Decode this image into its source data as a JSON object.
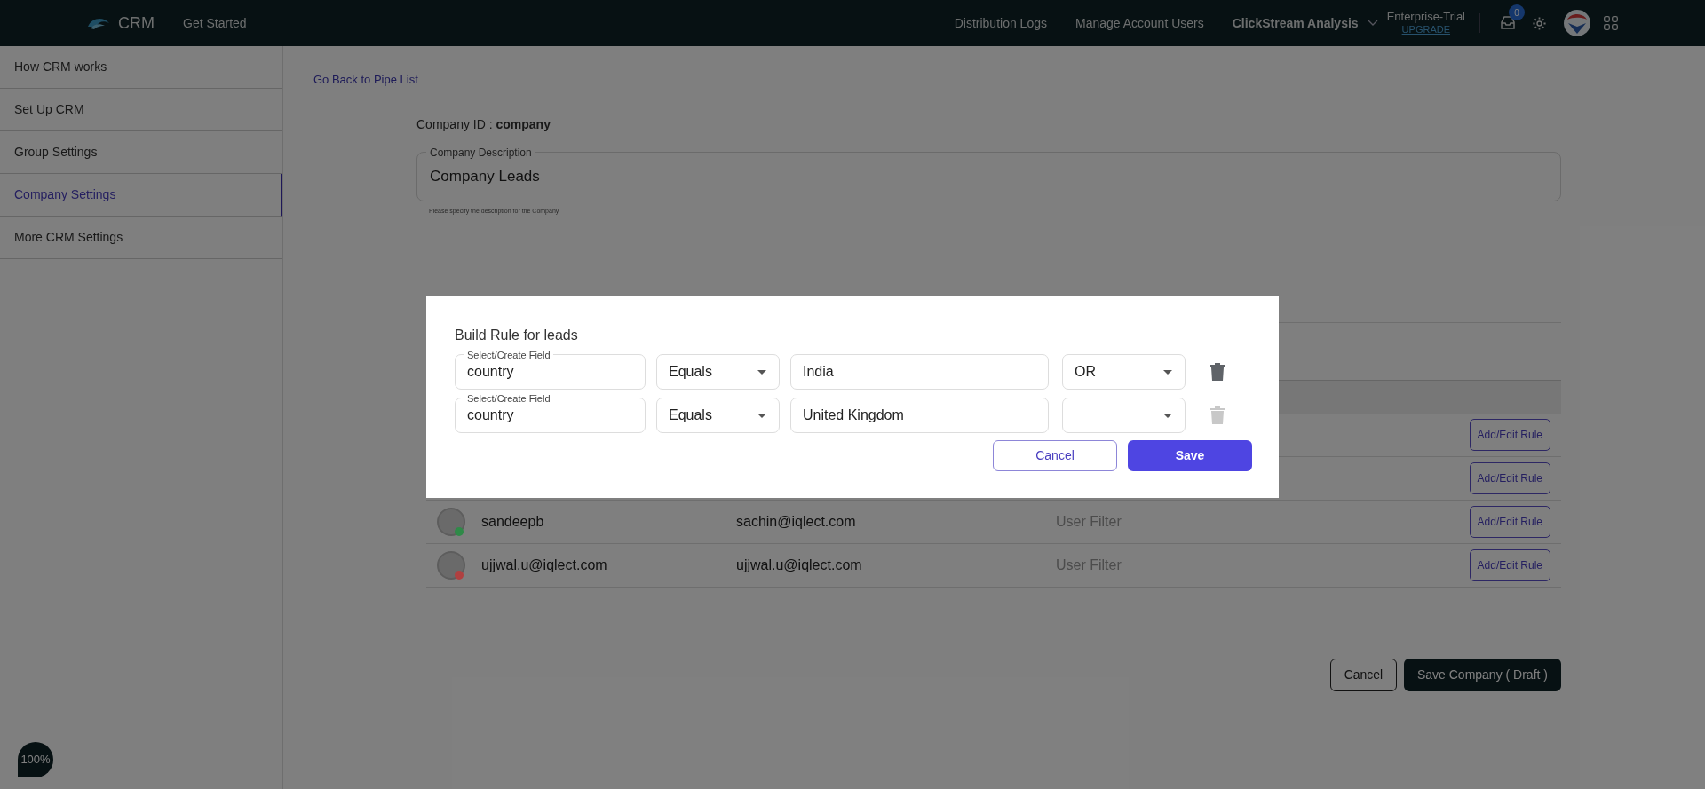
{
  "topbar": {
    "logo_text": "CRM",
    "get_started": "Get Started",
    "links": [
      {
        "label": "Distribution Logs",
        "bold": false
      },
      {
        "label": "Manage Account Users",
        "bold": false
      },
      {
        "label": "ClickStream Analysis",
        "bold": true
      }
    ],
    "plan": {
      "name": "Enterprise-Trial",
      "upgrade": "UPGRADE"
    },
    "notifications": "0"
  },
  "sidebar": {
    "items": [
      {
        "label": "How CRM works",
        "selected": false
      },
      {
        "label": "Set Up CRM",
        "selected": false
      },
      {
        "label": "Group Settings",
        "selected": false
      },
      {
        "label": "Company Settings",
        "selected": true
      },
      {
        "label": "More CRM Settings",
        "selected": false
      }
    ]
  },
  "back_link": "Go Back to Pipe List",
  "company_id": {
    "label": "Company ID : ",
    "value": "company"
  },
  "description": {
    "label": "Company Description",
    "value": "Company Leads",
    "helper": "Please specify the description for the Company"
  },
  "table": {
    "rows": [
      {
        "action": "Add/Edit Rule"
      },
      {
        "action": "Add/Edit Rule"
      },
      {
        "name": "sandeepb",
        "email": "sachin@iqlect.com",
        "filter": "User Filter",
        "action": "Add/Edit Rule",
        "color": "#2f8a48"
      },
      {
        "name": "ujjwal.u@iqlect.com",
        "email": "ujjwal.u@iqlect.com",
        "filter": "User Filter",
        "action": "Add/Edit Rule",
        "color": "#b04040"
      }
    ]
  },
  "footer_buttons": {
    "cancel": "Cancel",
    "save": "Save Company ( Draft )"
  },
  "zoom_badge": "100%",
  "modal": {
    "title": "Build Rule for leads",
    "rules": [
      {
        "field_label": "Select/Create Field",
        "field": "country",
        "operator": "Equals",
        "value": "India",
        "connector": "OR",
        "delete_disabled": false
      },
      {
        "field_label": "Select/Create Field",
        "field": "country",
        "operator": "Equals",
        "value": "United Kingdom",
        "delete_disabled": true
      }
    ],
    "cancel": "Cancel",
    "save": "Save"
  }
}
